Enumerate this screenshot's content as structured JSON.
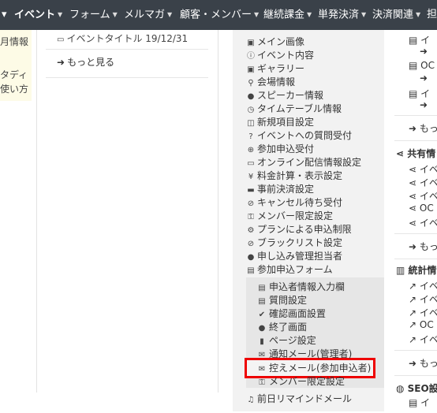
{
  "nav": {
    "items": [
      {
        "label": "イベント",
        "active": true
      },
      {
        "label": "フォーム"
      },
      {
        "label": "メルマガ"
      },
      {
        "label": "顧客・メンバー"
      },
      {
        "label": "継続課金"
      },
      {
        "label": "単発決済"
      },
      {
        "label": "決済関連"
      },
      {
        "label": "担"
      }
    ],
    "leading_caret": "▾"
  },
  "left": {
    "line1": "月情報",
    "line2": "タディ",
    "line3": "使い方"
  },
  "col2": {
    "event_title": "イベントタイトル 19/12/31",
    "more": "もっと見る"
  },
  "menu": {
    "items": [
      {
        "icon": "image-icon",
        "glyph": "▣",
        "label": "メイン画像"
      },
      {
        "icon": "info-icon",
        "glyph": "ⓘ",
        "label": "イベント内容"
      },
      {
        "icon": "gallery-icon",
        "glyph": "▣",
        "label": "ギャラリー"
      },
      {
        "icon": "map-marker-icon",
        "glyph": "⚲",
        "label": "会場情報"
      },
      {
        "icon": "user-icon",
        "glyph": "●",
        "label": "スピーカー情報"
      },
      {
        "icon": "clock-icon",
        "glyph": "◷",
        "label": "タイムテーブル情報"
      },
      {
        "icon": "columns-icon",
        "glyph": "◫",
        "label": "新規項目設定"
      },
      {
        "icon": "question-icon",
        "glyph": "?",
        "label": "イベントへの質問受付"
      },
      {
        "icon": "plus-circle-icon",
        "glyph": "⊕",
        "label": "参加申込受付"
      },
      {
        "icon": "monitor-icon",
        "glyph": "▭",
        "label": "オンライン配信情報設定"
      },
      {
        "icon": "yen-icon",
        "glyph": "¥",
        "label": "料金計算・表示設定"
      },
      {
        "icon": "credit-card-icon",
        "glyph": "▬",
        "label": "事前決済設定"
      },
      {
        "icon": "ban-icon",
        "glyph": "⊘",
        "label": "キャンセル待ち受付"
      },
      {
        "icon": "key-icon",
        "glyph": "⚿",
        "label": "メンバー限定設定"
      },
      {
        "icon": "gear-icon",
        "glyph": "⚙",
        "label": "プランによる申込制限"
      },
      {
        "icon": "ban-icon",
        "glyph": "⊘",
        "label": "ブラックリスト設定"
      },
      {
        "icon": "users-icon",
        "glyph": "●",
        "label": "申し込み管理担当者"
      },
      {
        "icon": "list-icon",
        "glyph": "▤",
        "label": "参加申込フォーム"
      }
    ],
    "submenu": [
      {
        "icon": "list-icon",
        "glyph": "▤",
        "label": "申込者情報入力欄"
      },
      {
        "icon": "list-icon",
        "glyph": "▤",
        "label": "質問設定"
      },
      {
        "icon": "check-circle-icon",
        "glyph": "✔",
        "label": "確認画面設置"
      },
      {
        "icon": "comment-icon",
        "glyph": "●",
        "label": "終了画面"
      },
      {
        "icon": "file-icon",
        "glyph": "▮",
        "label": "ページ設定"
      },
      {
        "icon": "envelope-icon",
        "glyph": "✉",
        "label": "通知メール(管理者)"
      },
      {
        "icon": "envelope-icon",
        "glyph": "✉",
        "label": "控えメール(参加申込者)"
      },
      {
        "icon": "key-icon",
        "glyph": "⚿",
        "label": "メンバー限定設定"
      }
    ],
    "after": {
      "icon": "bell-icon",
      "glyph": "♫",
      "label": "前日リマインドメール"
    }
  },
  "right": {
    "more1": "もっ",
    "share_head": "共有情",
    "share_items": [
      "イベ",
      "イベ",
      "イベ",
      "OC",
      "イベ"
    ],
    "more2": "もっ",
    "stats_head": "統計情",
    "stats_items": [
      "イベ",
      "イベ",
      "イベ",
      "OC",
      "イベ"
    ],
    "more3": "もっ",
    "seo_head": "SEO設",
    "top_items": [
      "イ",
      "OC",
      "イ"
    ],
    "seo_item": "イ"
  },
  "colors": {
    "nav_bg": "#3a4149",
    "highlight": "#e00000",
    "menu_bg": "#f2f2f2"
  }
}
